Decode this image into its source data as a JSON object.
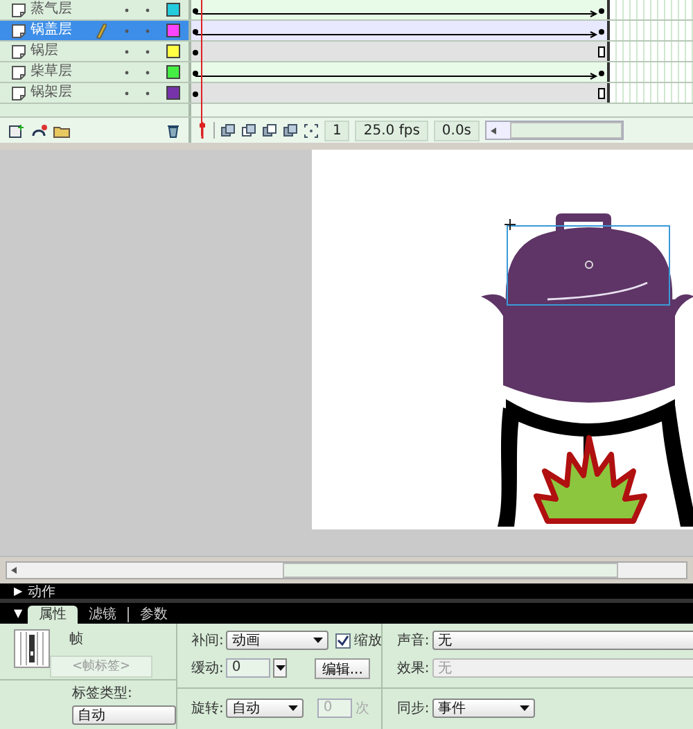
{
  "timeline": {
    "layers": [
      {
        "name": "蒸气层",
        "selected": false,
        "color": "#22ccdd",
        "kind": "motion"
      },
      {
        "name": "锅盖层",
        "selected": true,
        "color": "#ff44ff",
        "kind": "motion"
      },
      {
        "name": "锅层",
        "selected": false,
        "color": "#ffff44",
        "kind": "static"
      },
      {
        "name": "柴草层",
        "selected": false,
        "color": "#44ee44",
        "kind": "motion"
      },
      {
        "name": "锅架层",
        "selected": false,
        "color": "#7733aa",
        "kind": "static"
      }
    ],
    "toolbar": {
      "frame": "1",
      "fps": "25.0 fps",
      "time": "0.0s"
    }
  },
  "actions_panel": {
    "toggle": "▶",
    "title": "动作"
  },
  "properties_panel": {
    "toggle": "▼",
    "tabs": [
      {
        "label": "属性",
        "selected": true
      },
      {
        "label": "滤镜",
        "selected": false
      },
      {
        "label": "参数",
        "selected": false
      }
    ],
    "frame_title": "帧",
    "label_field": {
      "placeholder": "<帧标签>"
    },
    "label_type": {
      "label": "标签类型:",
      "value": "自动"
    },
    "tween": {
      "label": "补间:",
      "value": "动画"
    },
    "scale": {
      "label": "缩放",
      "checked": true
    },
    "ease": {
      "label": "缓动:",
      "value": "0"
    },
    "edit_button": "编辑...",
    "rotate": {
      "label": "旋转:",
      "value": "自动"
    },
    "times": {
      "value": "0",
      "unit": "次",
      "disabled": true
    },
    "sound": {
      "label": "声音:",
      "value": "无"
    },
    "effect": {
      "label": "效果:",
      "value": "无",
      "disabled": true
    },
    "sync": {
      "label": "同步:",
      "value": "事件"
    }
  }
}
